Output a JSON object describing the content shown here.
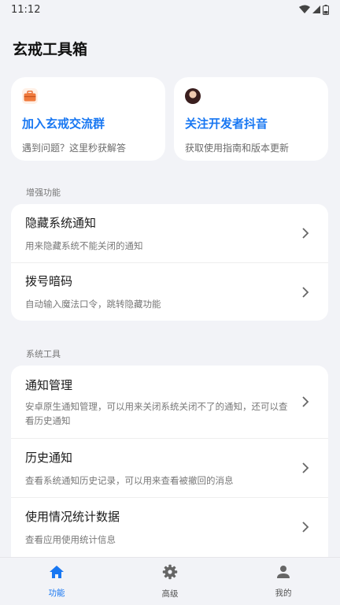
{
  "status_bar": {
    "time": "11:12"
  },
  "app": {
    "title": "玄戒工具箱"
  },
  "top_cards": [
    {
      "icon": "briefcase-icon",
      "title": "加入玄戒交流群",
      "subtitle": "遇到问题？这里秒获解答"
    },
    {
      "icon": "avatar-icon",
      "title": "关注开发者抖音",
      "subtitle": "获取使用指南和版本更新"
    }
  ],
  "sections": [
    {
      "label": "增强功能",
      "items": [
        {
          "title": "隐藏系统通知",
          "subtitle": "用来隐藏系统不能关闭的通知"
        },
        {
          "title": "拨号暗码",
          "subtitle": "自动输入魔法口令，跳转隐藏功能"
        }
      ]
    },
    {
      "label": "系统工具",
      "items": [
        {
          "title": "通知管理",
          "subtitle": "安卓原生通知管理，可以用来关闭系统关闭不了的通知，还可以查看历史通知"
        },
        {
          "title": "历史通知",
          "subtitle": "查看系统通知历史记录，可以用来查看被撤回的消息"
        },
        {
          "title": "使用情况统计数据",
          "subtitle": "查看应用使用统计信息"
        }
      ]
    }
  ],
  "bottom_nav": [
    {
      "icon": "home-icon",
      "label": "功能",
      "active": true
    },
    {
      "icon": "gear-icon",
      "label": "高级",
      "active": false
    },
    {
      "icon": "person-icon",
      "label": "我的",
      "active": false
    }
  ],
  "colors": {
    "accent": "#1877f2",
    "background": "#f2f3f7",
    "card": "#ffffff"
  }
}
